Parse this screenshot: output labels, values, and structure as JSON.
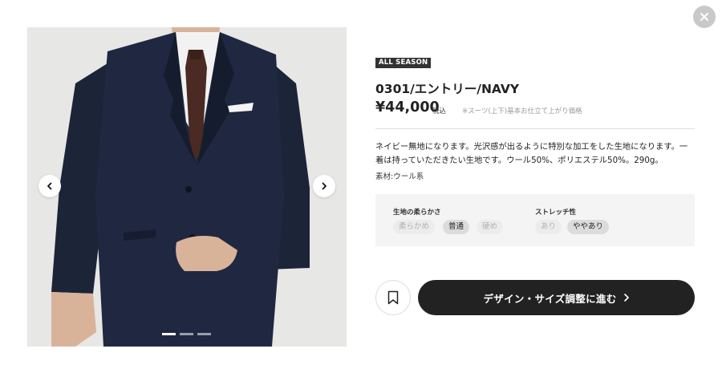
{
  "product": {
    "badge": "ALL SEASON",
    "name": "0301/エントリー/NAVY",
    "price": "¥44,000",
    "tax_label": "税込",
    "price_note": "※スーツ(上下)基本お仕立て上がり価格",
    "description": "ネイビー無地になります。光沢感が出るように特別な加工をした生地になります。一着は持っていただきたい生地です。ウール50%、ポリエステル50%。290g。",
    "material": "素材:ウール系"
  },
  "specs": {
    "softness": {
      "title": "生地の柔らかさ",
      "options": [
        "柔らかめ",
        "普通",
        "硬め"
      ],
      "selected": "普通"
    },
    "stretch": {
      "title": "ストレッチ性",
      "options": [
        "あり",
        "ややあり"
      ],
      "selected": "ややあり"
    }
  },
  "actions": {
    "cta_label": "デザイン・サイズ調整に進む"
  },
  "gallery": {
    "image_count": 3,
    "active_index": 0
  },
  "icons": {
    "close": "close-icon",
    "prev": "chevron-left-icon",
    "next": "chevron-right-icon",
    "bookmark": "bookmark-icon",
    "cta_arrow": "chevron-right-icon"
  },
  "colors": {
    "badge_bg": "#333333",
    "cta_bg": "#222222",
    "suit_navy": "#1c2438",
    "tie_brown": "#4a2a22",
    "specs_bg": "#f4f4f4"
  }
}
